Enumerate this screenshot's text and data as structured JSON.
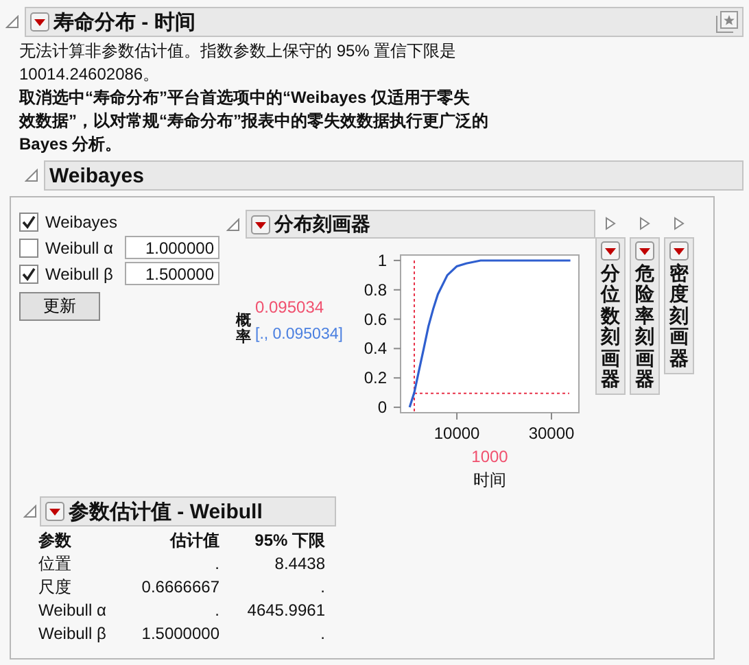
{
  "report": {
    "title": "寿命分布 - 时间",
    "expanded": true,
    "messages": [
      {
        "bold": false,
        "lines": [
          "无法计算非参数估计值。指数参数上保守的 95% 置信下限是",
          "10014.24602086。"
        ]
      },
      {
        "bold": true,
        "lines": [
          "取消选中“寿命分布”平台首选项中的“Weibayes 仅适用于零失",
          "效数据”，以对常规“寿命分布”报表中的零失效数据执行更广泛的",
          "Bayes 分析。"
        ]
      }
    ],
    "weibayes": {
      "title": "Weibayes",
      "expanded": true,
      "controls": [
        {
          "kind": "check",
          "label": "Weibayes",
          "checked": true
        },
        {
          "kind": "check_field",
          "label": "Weibull α",
          "checked": false,
          "value": "1.000000"
        },
        {
          "kind": "check_field",
          "label": "Weibull β",
          "checked": true,
          "value": "1.500000"
        }
      ],
      "button": "更新",
      "profiler": {
        "title": "分布刻画器",
        "expanded": true,
        "y_label": "概率",
        "interval": "[., 0.095034]",
        "chart_data": {
          "type": "line",
          "xlabel": "时间",
          "xlim": [
            -1900,
            35800
          ],
          "ylim": [
            -0.037,
            1.037
          ],
          "xticks": [
            {
              "value": 10000,
              "label": "10000"
            },
            {
              "value": 30000,
              "label": "30000"
            }
          ],
          "yticks": [
            0,
            0.2,
            0.4,
            0.6,
            0.8,
            1
          ],
          "x": [
            0,
            1000,
            2000,
            3000,
            4000,
            5000,
            6000,
            8000,
            10000,
            12000,
            15000,
            20000,
            25000,
            30000,
            34000
          ],
          "series": [
            {
              "color": "#2f5fcf",
              "values": [
                0,
                0.1,
                0.25,
                0.4,
                0.55,
                0.67,
                0.77,
                0.9,
                0.96,
                0.98,
                1,
                1,
                1,
                1,
                1
              ]
            }
          ],
          "ref_lines": [
            {
              "axis": "x",
              "value": 1000,
              "label": "1000"
            },
            {
              "axis": "y",
              "value": 0.095034,
              "label": "0.095034"
            }
          ]
        }
      },
      "collapsed": [
        {
          "title": "分位数刻画器",
          "expanded": false
        },
        {
          "title": "危险率刻画器",
          "expanded": false
        },
        {
          "title": "密度刻画器",
          "expanded": false
        }
      ],
      "estimates": {
        "title": "参数估计值 - Weibull",
        "expanded": true,
        "columns": [
          "参数",
          "估计值",
          "95% 下限"
        ],
        "rows": [
          [
            "位置",
            ".",
            "8.4438"
          ],
          [
            "尺度",
            "0.6666667",
            "."
          ],
          [
            "Weibull α",
            ".",
            "4645.9961"
          ],
          [
            "Weibull β",
            "1.5000000",
            "."
          ]
        ]
      }
    }
  }
}
